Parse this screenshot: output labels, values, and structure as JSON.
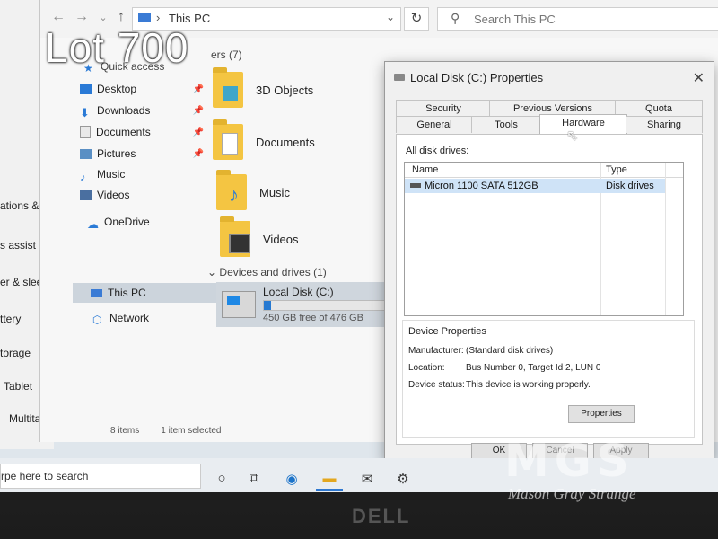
{
  "explorer": {
    "address": "This PC",
    "search_placeholder": "Search This PC",
    "folders_heading": "ers (7)",
    "sidebar": [
      {
        "label": "Quick access",
        "pinned": false
      },
      {
        "label": "Desktop",
        "pinned": true
      },
      {
        "label": "Downloads",
        "pinned": true
      },
      {
        "label": "Documents",
        "pinned": true
      },
      {
        "label": "Pictures",
        "pinned": true
      },
      {
        "label": "Music",
        "pinned": false
      },
      {
        "label": "Videos",
        "pinned": false
      },
      {
        "label": "OneDrive",
        "pinned": false
      },
      {
        "label": "This PC",
        "pinned": false,
        "selected": true
      },
      {
        "label": "Network",
        "pinned": false
      }
    ],
    "folders": [
      "3D Objects",
      "Documents",
      "Music",
      "Videos"
    ],
    "devices_heading": "Devices and drives (1)",
    "drive": {
      "label": "Local Disk (C:)",
      "free_text": "450 GB free of 476 GB",
      "used_fraction": 0.055
    },
    "status": {
      "items": "8 items",
      "selected": "1 item selected"
    }
  },
  "settings": {
    "items": [
      "ations & actio",
      "s assist",
      "er & sleep",
      "ttery",
      "torage",
      "Tablet",
      "Multitasking"
    ]
  },
  "dialog": {
    "title": "Local Disk (C:) Properties",
    "tabs_back": [
      "Security",
      "Previous Versions",
      "Quota"
    ],
    "tabs_front": [
      "General",
      "Tools",
      "Hardware",
      "Sharing"
    ],
    "active_tab": "Hardware",
    "all_disk_drives_label": "All disk drives:",
    "columns": {
      "name": "Name",
      "type": "Type"
    },
    "disk": {
      "name": "Micron 1100 SATA 512GB",
      "type": "Disk drives"
    },
    "device_properties": {
      "title": "Device Properties",
      "manufacturer_label": "Manufacturer:",
      "manufacturer": "(Standard disk drives)",
      "location_label": "Location:",
      "location": "Bus Number 0, Target Id 2, LUN 0",
      "status_label": "Device status:",
      "status": "This device is working properly.",
      "properties_button": "Properties"
    },
    "buttons": {
      "ok": "OK",
      "cancel": "Cancel",
      "apply": "Apply"
    }
  },
  "taskbar": {
    "search_text": "rpe here to search"
  },
  "overlay": {
    "lot": "Lot 700",
    "watermark_logo": "MGS",
    "watermark_name": "Mason Gray Strange",
    "bezel_brand": "DELL"
  },
  "colors": {
    "accent": "#2679d1",
    "selection": "#cfe3f7"
  }
}
